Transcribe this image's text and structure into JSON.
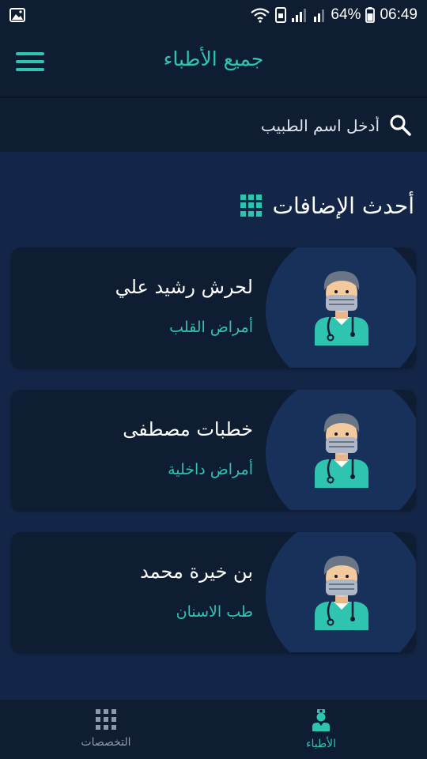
{
  "status_bar": {
    "battery": "64%",
    "time": "06:49",
    "icons": [
      "image-icon",
      "wifi-icon",
      "signal-icon",
      "battery-icon"
    ]
  },
  "app_bar": {
    "title": "جميع الأطباء",
    "menu_icon": "hamburger-menu-icon"
  },
  "search": {
    "placeholder": "أدخل اسم الطبيب",
    "icon": "search-icon"
  },
  "section": {
    "title": "أحدث الإضافات",
    "icon": "grid-icon"
  },
  "doctors": [
    {
      "name": "لحرش رشيد علي",
      "specialty": "أمراض القلب",
      "avatar": "doctor-avatar-icon"
    },
    {
      "name": "خطبات مصطفى",
      "specialty": "أمراض داخلية",
      "avatar": "doctor-avatar-icon"
    },
    {
      "name": "بن خيرة محمد",
      "specialty": "طب الاسنان",
      "avatar": "doctor-avatar-icon"
    }
  ],
  "bottom_nav": {
    "items": [
      {
        "label": "التخصصات",
        "icon": "grid-icon",
        "active": false
      },
      {
        "label": "الأطباء",
        "icon": "doctor-icon",
        "active": true
      }
    ]
  },
  "colors": {
    "background": "#142647",
    "surface": "#0f1d33",
    "accent": "#2ec4b0",
    "card_circle": "#18315a"
  }
}
